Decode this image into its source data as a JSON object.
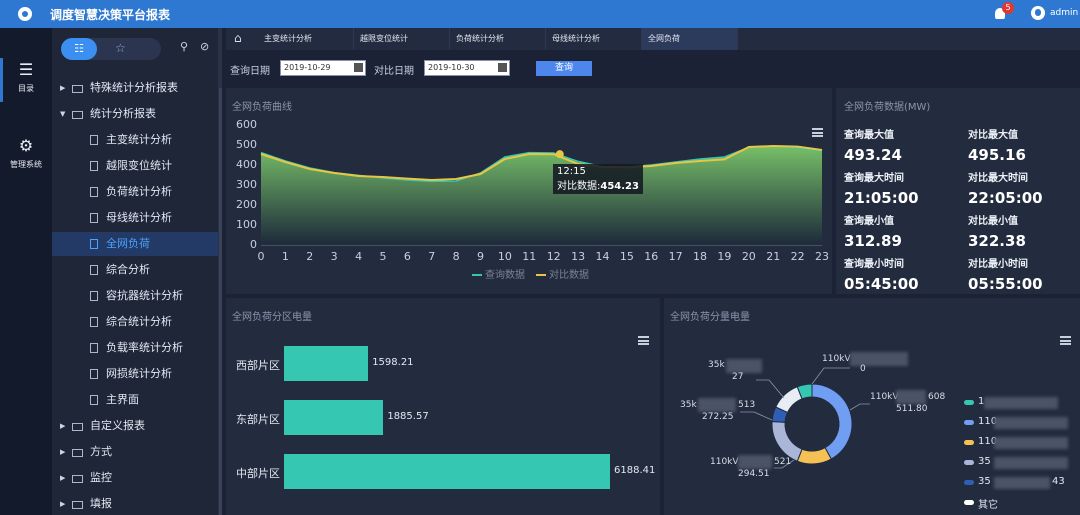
{
  "header": {
    "title": "调度智慧决策平台报表",
    "notification_count": "5",
    "username": "admin"
  },
  "left_rail": [
    {
      "label": "目录",
      "icon": "list-icon"
    },
    {
      "label": "管理系统",
      "icon": "gear-icon"
    }
  ],
  "tree": {
    "items": [
      {
        "label": "特殊统计分析报表",
        "type": "folder",
        "expanded": false,
        "level": 0
      },
      {
        "label": "统计分析报表",
        "type": "folder",
        "expanded": true,
        "level": 0
      },
      {
        "label": "主变统计分析",
        "type": "file",
        "level": 1
      },
      {
        "label": "越限变位统计",
        "type": "file",
        "level": 1
      },
      {
        "label": "负荷统计分析",
        "type": "file",
        "level": 1
      },
      {
        "label": "母线统计分析",
        "type": "file",
        "level": 1
      },
      {
        "label": "全网负荷",
        "type": "file",
        "level": 1,
        "active": true
      },
      {
        "label": "综合分析",
        "type": "file",
        "level": 1
      },
      {
        "label": "容抗器统计分析",
        "type": "file",
        "level": 1
      },
      {
        "label": "综合统计分析",
        "type": "file",
        "level": 1
      },
      {
        "label": "负载率统计分析",
        "type": "file",
        "level": 1
      },
      {
        "label": "网损统计分析",
        "type": "file",
        "level": 1
      },
      {
        "label": "主界面",
        "type": "file",
        "level": 1
      },
      {
        "label": "自定义报表",
        "type": "folder",
        "expanded": false,
        "level": 0
      },
      {
        "label": "方式",
        "type": "folder",
        "expanded": false,
        "level": 0
      },
      {
        "label": "监控",
        "type": "folder",
        "expanded": false,
        "level": 0
      },
      {
        "label": "填报",
        "type": "folder",
        "expanded": false,
        "level": 0
      }
    ]
  },
  "tabs": [
    {
      "label": "主变统计分析"
    },
    {
      "label": "越限变位统计"
    },
    {
      "label": "负荷统计分析"
    },
    {
      "label": "母线统计分析"
    },
    {
      "label": "全网负荷",
      "active": true
    }
  ],
  "filters": {
    "query_date_label": "查询日期",
    "query_date": "2019-10-29",
    "compare_date_label": "对比日期",
    "compare_date": "2019-10-30",
    "query_button": "查询"
  },
  "load_curve": {
    "title": "全网负荷曲线",
    "tooltip": {
      "time": "12:15",
      "series": "对比数据",
      "value": "454.23"
    }
  },
  "load_stats": {
    "title": "全网负荷数据(MW)",
    "items": [
      {
        "label": "查询最大值",
        "value": "493.24"
      },
      {
        "label": "对比最大值",
        "value": "495.16"
      },
      {
        "label": "查询最大时间",
        "value": "21:05:00"
      },
      {
        "label": "对比最大时间",
        "value": "22:05:00"
      },
      {
        "label": "查询最小值",
        "value": "312.89"
      },
      {
        "label": "对比最小值",
        "value": "322.38"
      },
      {
        "label": "查询最小时间",
        "value": "05:45:00"
      },
      {
        "label": "对比最小时间",
        "value": "05:55:00"
      }
    ]
  },
  "zone_panel": {
    "title": "全网负荷分区电量"
  },
  "voltage_panel": {
    "title": "全网负荷分量电量",
    "visible_labels": [
      {
        "text": "110kV"
      },
      {
        "text": "35k"
      },
      {
        "text": "27"
      },
      {
        "text": "35k"
      },
      {
        "text": "513"
      },
      {
        "text": "272.25"
      },
      {
        "text": "110kV"
      },
      {
        "text": "608"
      },
      {
        "text": "511.80"
      },
      {
        "text": "110kV"
      },
      {
        "text": "521"
      },
      {
        "text": "294.51"
      },
      {
        "text": "0"
      }
    ],
    "legend": [
      {
        "text": "1",
        "color": "#36c7b2"
      },
      {
        "text": "110",
        "color": "#6f9ef2"
      },
      {
        "text": "110",
        "color": "#f5c154"
      },
      {
        "text": "35",
        "color": "#a9b6d8"
      },
      {
        "text": "35",
        "color": "#2f5fb5",
        "suffix": "43"
      },
      {
        "text": "其它",
        "color": "#ffffff"
      }
    ]
  },
  "chart_data": [
    {
      "type": "area",
      "title": "全网负荷曲线",
      "x": [
        "0",
        "1",
        "2",
        "3",
        "4",
        "5",
        "6",
        "7",
        "8",
        "9",
        "10",
        "11",
        "12",
        "13",
        "14",
        "15",
        "16",
        "17",
        "18",
        "19",
        "20",
        "21",
        "22",
        "23"
      ],
      "ylim": [
        0,
        600
      ],
      "yticks": [
        "0",
        "100",
        "200",
        "300",
        "400",
        "500",
        "600"
      ],
      "series": [
        {
          "name": "查询数据",
          "color": "#36c7b2",
          "values": [
            462,
            420,
            385,
            362,
            348,
            335,
            325,
            318,
            320,
            360,
            440,
            462,
            460,
            418,
            392,
            390,
            400,
            415,
            430,
            440,
            488,
            493,
            486,
            470
          ]
        },
        {
          "name": "对比数据",
          "color": "#e8c542",
          "values": [
            455,
            415,
            380,
            360,
            345,
            340,
            332,
            325,
            330,
            355,
            430,
            455,
            454,
            405,
            390,
            388,
            395,
            410,
            420,
            428,
            490,
            495,
            492,
            475
          ]
        }
      ],
      "legend_position": "bottom",
      "highlight": {
        "x": "12:15",
        "series": "对比数据",
        "value": 454.23
      }
    },
    {
      "type": "bar",
      "title": "全网负荷分区电量",
      "categories": [
        "西部片区",
        "东部片区",
        "中部片区"
      ],
      "values": [
        1598.21,
        1885.57,
        6188.41
      ],
      "orientation": "horizontal",
      "color": "#36c7b2"
    },
    {
      "type": "pie",
      "title": "全网负荷分量电量",
      "values": [
        42,
        14,
        20,
        6,
        12,
        6
      ],
      "colors": [
        "#6f9ef2",
        "#f5c154",
        "#a9b6d8",
        "#2f5fb5",
        "#e8ecf5",
        "#36c7b2"
      ]
    }
  ]
}
